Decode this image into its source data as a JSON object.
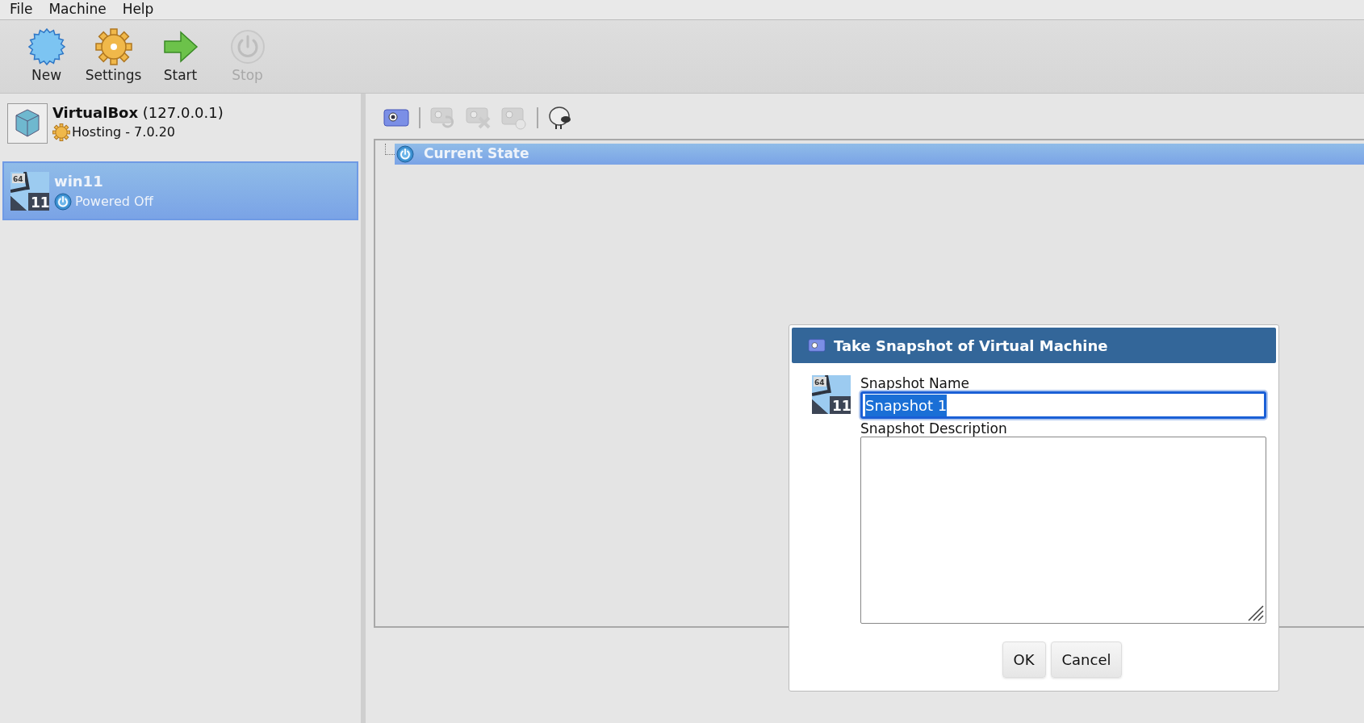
{
  "menu": [
    "File",
    "Machine",
    "Help"
  ],
  "toolbar": [
    {
      "kind": "new",
      "label": "New",
      "disabled": false
    },
    {
      "kind": "settings",
      "label": "Settings",
      "disabled": false
    },
    {
      "kind": "start",
      "label": "Start",
      "disabled": false
    },
    {
      "kind": "stop",
      "label": "Stop",
      "disabled": true
    }
  ],
  "host": {
    "name": "VirtualBox",
    "address": "(127.0.0.1)",
    "status": "Hosting - 7.0.20"
  },
  "machines": [
    {
      "name": "win11",
      "state": "Powered Off",
      "selected": true,
      "os_badge": {
        "bits": "64",
        "version": "11"
      }
    }
  ],
  "snapshot_tools": [
    {
      "kind": "take",
      "disabled": false
    },
    {
      "kind": "restore",
      "disabled": true
    },
    {
      "kind": "delete",
      "disabled": true
    },
    {
      "kind": "details",
      "disabled": true
    },
    {
      "kind": "clone",
      "disabled": false
    }
  ],
  "tree": [
    {
      "label": "Current State",
      "selected": true
    }
  ],
  "dialog": {
    "os_badge": {
      "bits": "64",
      "version": "11"
    },
    "title": "Take Snapshot of Virtual Machine",
    "name_label": "Snapshot Name",
    "name_value": "Snapshot 1",
    "description_label": "Snapshot Description",
    "buttons": [
      "OK",
      "Cancel"
    ]
  }
}
